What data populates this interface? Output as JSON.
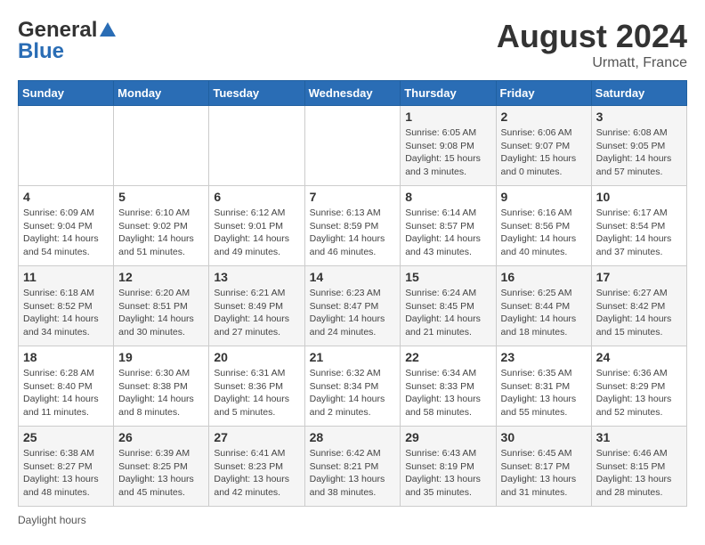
{
  "header": {
    "logo_general": "General",
    "logo_blue": "Blue",
    "month_year": "August 2024",
    "location": "Urmatt, France"
  },
  "days_of_week": [
    "Sunday",
    "Monday",
    "Tuesday",
    "Wednesday",
    "Thursday",
    "Friday",
    "Saturday"
  ],
  "weeks": [
    [
      {
        "day": "",
        "info": ""
      },
      {
        "day": "",
        "info": ""
      },
      {
        "day": "",
        "info": ""
      },
      {
        "day": "",
        "info": ""
      },
      {
        "day": "1",
        "info": "Sunrise: 6:05 AM\nSunset: 9:08 PM\nDaylight: 15 hours\nand 3 minutes."
      },
      {
        "day": "2",
        "info": "Sunrise: 6:06 AM\nSunset: 9:07 PM\nDaylight: 15 hours\nand 0 minutes."
      },
      {
        "day": "3",
        "info": "Sunrise: 6:08 AM\nSunset: 9:05 PM\nDaylight: 14 hours\nand 57 minutes."
      }
    ],
    [
      {
        "day": "4",
        "info": "Sunrise: 6:09 AM\nSunset: 9:04 PM\nDaylight: 14 hours\nand 54 minutes."
      },
      {
        "day": "5",
        "info": "Sunrise: 6:10 AM\nSunset: 9:02 PM\nDaylight: 14 hours\nand 51 minutes."
      },
      {
        "day": "6",
        "info": "Sunrise: 6:12 AM\nSunset: 9:01 PM\nDaylight: 14 hours\nand 49 minutes."
      },
      {
        "day": "7",
        "info": "Sunrise: 6:13 AM\nSunset: 8:59 PM\nDaylight: 14 hours\nand 46 minutes."
      },
      {
        "day": "8",
        "info": "Sunrise: 6:14 AM\nSunset: 8:57 PM\nDaylight: 14 hours\nand 43 minutes."
      },
      {
        "day": "9",
        "info": "Sunrise: 6:16 AM\nSunset: 8:56 PM\nDaylight: 14 hours\nand 40 minutes."
      },
      {
        "day": "10",
        "info": "Sunrise: 6:17 AM\nSunset: 8:54 PM\nDaylight: 14 hours\nand 37 minutes."
      }
    ],
    [
      {
        "day": "11",
        "info": "Sunrise: 6:18 AM\nSunset: 8:52 PM\nDaylight: 14 hours\nand 34 minutes."
      },
      {
        "day": "12",
        "info": "Sunrise: 6:20 AM\nSunset: 8:51 PM\nDaylight: 14 hours\nand 30 minutes."
      },
      {
        "day": "13",
        "info": "Sunrise: 6:21 AM\nSunset: 8:49 PM\nDaylight: 14 hours\nand 27 minutes."
      },
      {
        "day": "14",
        "info": "Sunrise: 6:23 AM\nSunset: 8:47 PM\nDaylight: 14 hours\nand 24 minutes."
      },
      {
        "day": "15",
        "info": "Sunrise: 6:24 AM\nSunset: 8:45 PM\nDaylight: 14 hours\nand 21 minutes."
      },
      {
        "day": "16",
        "info": "Sunrise: 6:25 AM\nSunset: 8:44 PM\nDaylight: 14 hours\nand 18 minutes."
      },
      {
        "day": "17",
        "info": "Sunrise: 6:27 AM\nSunset: 8:42 PM\nDaylight: 14 hours\nand 15 minutes."
      }
    ],
    [
      {
        "day": "18",
        "info": "Sunrise: 6:28 AM\nSunset: 8:40 PM\nDaylight: 14 hours\nand 11 minutes."
      },
      {
        "day": "19",
        "info": "Sunrise: 6:30 AM\nSunset: 8:38 PM\nDaylight: 14 hours\nand 8 minutes."
      },
      {
        "day": "20",
        "info": "Sunrise: 6:31 AM\nSunset: 8:36 PM\nDaylight: 14 hours\nand 5 minutes."
      },
      {
        "day": "21",
        "info": "Sunrise: 6:32 AM\nSunset: 8:34 PM\nDaylight: 14 hours\nand 2 minutes."
      },
      {
        "day": "22",
        "info": "Sunrise: 6:34 AM\nSunset: 8:33 PM\nDaylight: 13 hours\nand 58 minutes."
      },
      {
        "day": "23",
        "info": "Sunrise: 6:35 AM\nSunset: 8:31 PM\nDaylight: 13 hours\nand 55 minutes."
      },
      {
        "day": "24",
        "info": "Sunrise: 6:36 AM\nSunset: 8:29 PM\nDaylight: 13 hours\nand 52 minutes."
      }
    ],
    [
      {
        "day": "25",
        "info": "Sunrise: 6:38 AM\nSunset: 8:27 PM\nDaylight: 13 hours\nand 48 minutes."
      },
      {
        "day": "26",
        "info": "Sunrise: 6:39 AM\nSunset: 8:25 PM\nDaylight: 13 hours\nand 45 minutes."
      },
      {
        "day": "27",
        "info": "Sunrise: 6:41 AM\nSunset: 8:23 PM\nDaylight: 13 hours\nand 42 minutes."
      },
      {
        "day": "28",
        "info": "Sunrise: 6:42 AM\nSunset: 8:21 PM\nDaylight: 13 hours\nand 38 minutes."
      },
      {
        "day": "29",
        "info": "Sunrise: 6:43 AM\nSunset: 8:19 PM\nDaylight: 13 hours\nand 35 minutes."
      },
      {
        "day": "30",
        "info": "Sunrise: 6:45 AM\nSunset: 8:17 PM\nDaylight: 13 hours\nand 31 minutes."
      },
      {
        "day": "31",
        "info": "Sunrise: 6:46 AM\nSunset: 8:15 PM\nDaylight: 13 hours\nand 28 minutes."
      }
    ]
  ],
  "footer": {
    "note": "Daylight hours"
  }
}
